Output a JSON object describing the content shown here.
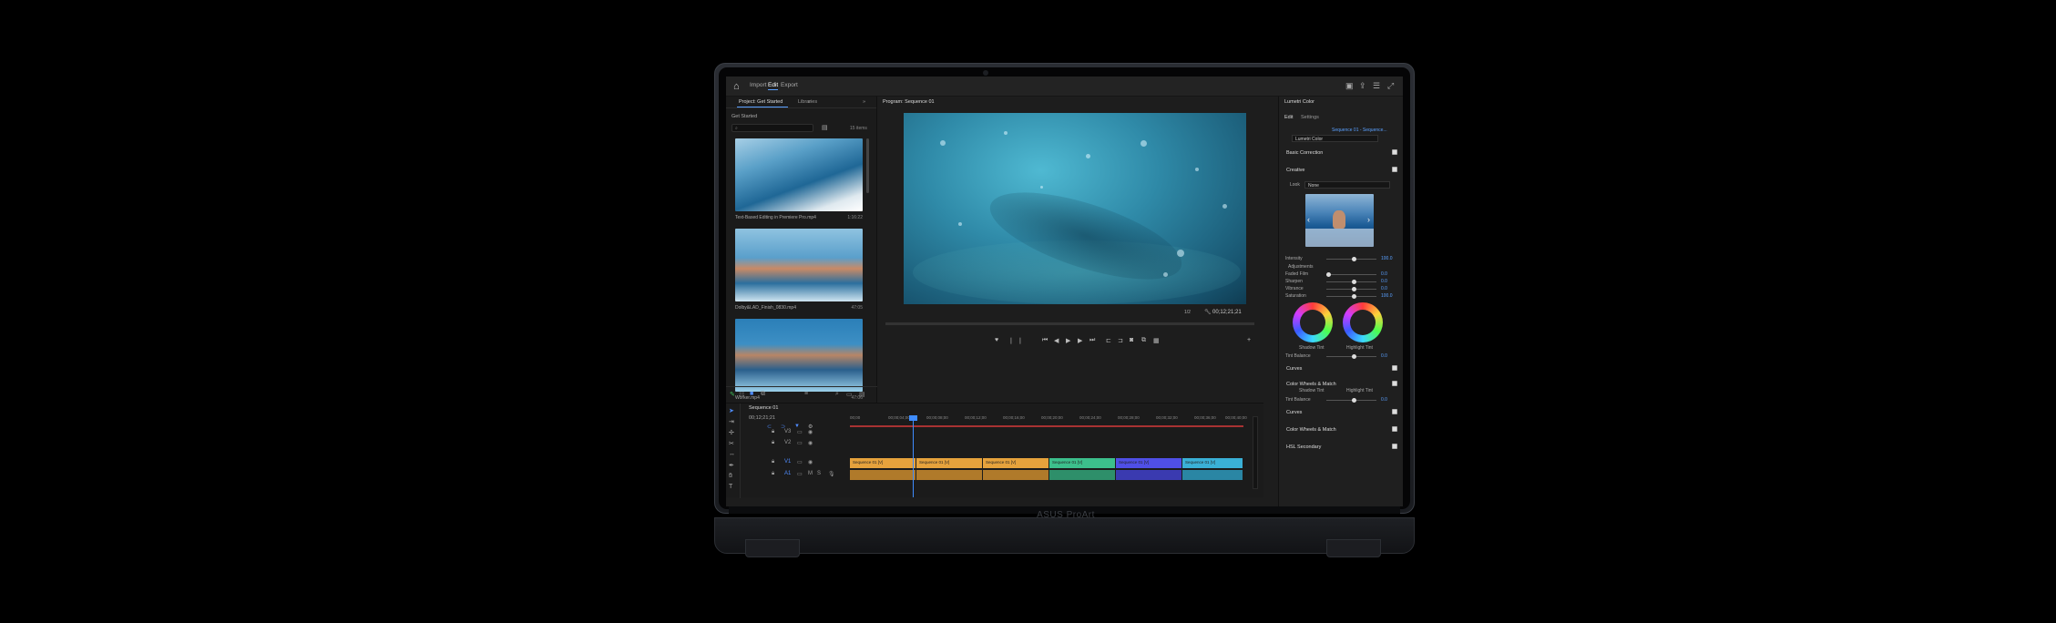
{
  "device": {
    "brand": "ASUS ProArt"
  },
  "topbar": {
    "tabs": [
      "Import",
      "Edit",
      "Export"
    ],
    "active_tab": "Edit"
  },
  "project": {
    "tab_project": "Project: Get Started",
    "tab_libraries": "Libraries",
    "path": "Get Started",
    "search_placeholder": "",
    "item_count": "15 items",
    "clips": [
      {
        "name": "Text-Based Editing in Premiere Pro.mp4",
        "duration": "1:16:22"
      },
      {
        "name": "Dolby&LAD_Finish_0830.mp4",
        "duration": "47:05"
      },
      {
        "name": "Worker.mp4",
        "duration": "47:06"
      }
    ]
  },
  "program": {
    "title": "Program: Sequence 01",
    "fit": "1/2",
    "timecode": "00;12;21;21"
  },
  "timeline": {
    "sequence": "Sequence 01",
    "ruler": [
      "00;00",
      "00;00;04;00",
      "00;00;08;00",
      "00;00;12;00",
      "00;00;16;00",
      "00;00;20;00",
      "00;00;24;00",
      "00;00;28;00",
      "00;00;32;00",
      "00;00;36;00",
      "00;00;40;00"
    ],
    "tracks": [
      "V3",
      "V2",
      "V1",
      "A1"
    ],
    "clips": [
      {
        "label": "Sequence 01 [V]",
        "color": "#e6a23c"
      },
      {
        "label": "Sequence 01 [V]",
        "color": "#e6a23c"
      },
      {
        "label": "Sequence 01 [V]",
        "color": "#e6a23c"
      },
      {
        "label": "Sequence 01 [V]",
        "color": "#3cbf8c"
      },
      {
        "label": "Sequence 01 [V]",
        "color": "#4f4fe6"
      },
      {
        "label": "Sequence 01 [V]",
        "color": "#3ab0d6"
      }
    ],
    "audio_colors": [
      "#b07a2a",
      "#b07a2a",
      "#b07a2a",
      "#2e8f6a",
      "#3a3ab0",
      "#2a86a4"
    ]
  },
  "lumetri": {
    "title": "Lumetri Color",
    "tab_edit": "Edit",
    "tab_settings": "Settings",
    "source": "Sequence 01 - Sequence...",
    "effect": "Lumetri Color",
    "sections": {
      "basic": "Basic Correction",
      "creative": "Creative",
      "curves": "Curves",
      "wheels": "Color Wheels & Match",
      "curves2": "Curves",
      "wheels2": "Color Wheels & Match",
      "hsl": "HSL Secondary"
    },
    "look_label": "Look",
    "look_value": "None",
    "intensity_label": "Intensity",
    "intensity_value": "100.0",
    "adjustments_label": "Adjustments",
    "adjust": [
      {
        "label": "Faded Film",
        "value": "0.0"
      },
      {
        "label": "Sharpen",
        "value": "0.0"
      },
      {
        "label": "Vibrance",
        "value": "0.0"
      },
      {
        "label": "Saturation",
        "value": "100.0"
      }
    ],
    "shadow_tint": "Shadow Tint",
    "highlight_tint": "Highlight Tint",
    "tint_balance_label": "Tint Balance",
    "tint_balance_value": "0.0",
    "tint_balance_value2": "0.0"
  }
}
